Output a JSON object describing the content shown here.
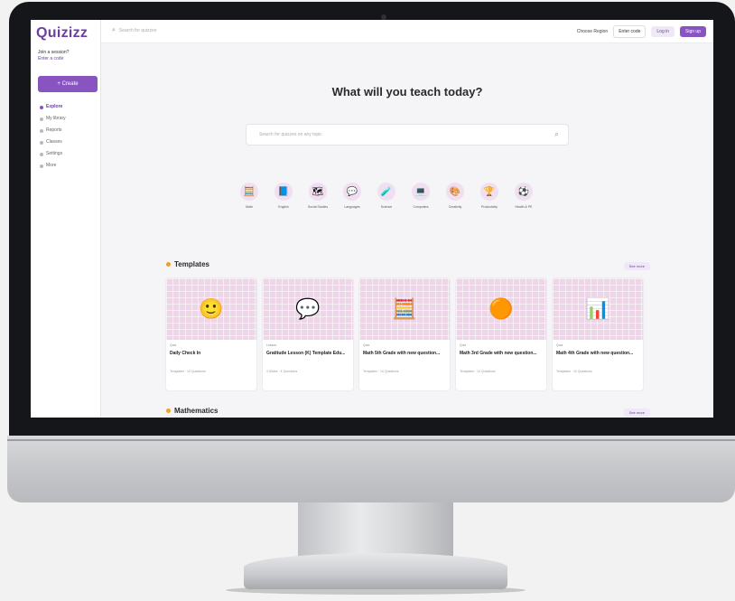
{
  "app": {
    "logo": "Quizizz"
  },
  "sidebar": {
    "join_text": "Join a session?",
    "join_link": "Enter a code",
    "create_label": "+ Create",
    "items": [
      {
        "label": "Explore",
        "active": true
      },
      {
        "label": "My library",
        "active": false
      },
      {
        "label": "Reports",
        "active": false
      },
      {
        "label": "Classes",
        "active": false
      },
      {
        "label": "Settings",
        "active": false
      },
      {
        "label": "More",
        "active": false
      }
    ]
  },
  "topbar": {
    "search_placeholder": "Search for quizzes",
    "language": "Choose Region",
    "join_label": "Enter code",
    "login_label": "Log in",
    "signup_label": "Sign up"
  },
  "main": {
    "headline": "What will you teach today?",
    "search_placeholder": "Search for quizzes on any topic",
    "subjects": [
      {
        "label": "Math",
        "icon": "math-icon",
        "glyph": "🧮"
      },
      {
        "label": "English",
        "icon": "english-icon",
        "glyph": "📘"
      },
      {
        "label": "Social Studies",
        "icon": "social-studies-icon",
        "glyph": "🗺"
      },
      {
        "label": "Languages",
        "icon": "languages-icon",
        "glyph": "💬"
      },
      {
        "label": "Science",
        "icon": "science-icon",
        "glyph": "🧪"
      },
      {
        "label": "Computers",
        "icon": "computers-icon",
        "glyph": "💻"
      },
      {
        "label": "Creativity",
        "icon": "creativity-icon",
        "glyph": "🎨"
      },
      {
        "label": "Productivity",
        "icon": "productivity-icon",
        "glyph": "🏆"
      },
      {
        "label": "Health & PE",
        "icon": "health-icon",
        "glyph": "⚽"
      }
    ],
    "templates_heading": "Templates",
    "templates_see_more": "See more",
    "templates": [
      {
        "tag": "Quiz",
        "title": "Daily Check In",
        "meta": "Templates · 10 Questions",
        "glyph": "🙂",
        "icon": "smiley-icon"
      },
      {
        "tag": "Lesson",
        "title": "Gratitude Lesson (K) Template Edu...",
        "meta": "3 Slides · 4 Questions",
        "glyph": "💬",
        "icon": "heart-bubble-icon"
      },
      {
        "tag": "Quiz",
        "title": "Math 5th Grade with new question...",
        "meta": "Templates · 10 Questions",
        "glyph": "🧮",
        "icon": "calculator-icon"
      },
      {
        "tag": "Quiz",
        "title": "Math 3rd Grade with new question...",
        "meta": "Templates · 10 Questions",
        "glyph": "🟠",
        "icon": "pie-chart-icon"
      },
      {
        "tag": "Quiz",
        "title": "Math 4th Grade with new question...",
        "meta": "Templates · 10 Questions",
        "glyph": "📊",
        "icon": "bar-chart-icon"
      }
    ],
    "math_heading": "Mathematics",
    "math_see_more": "See more"
  }
}
